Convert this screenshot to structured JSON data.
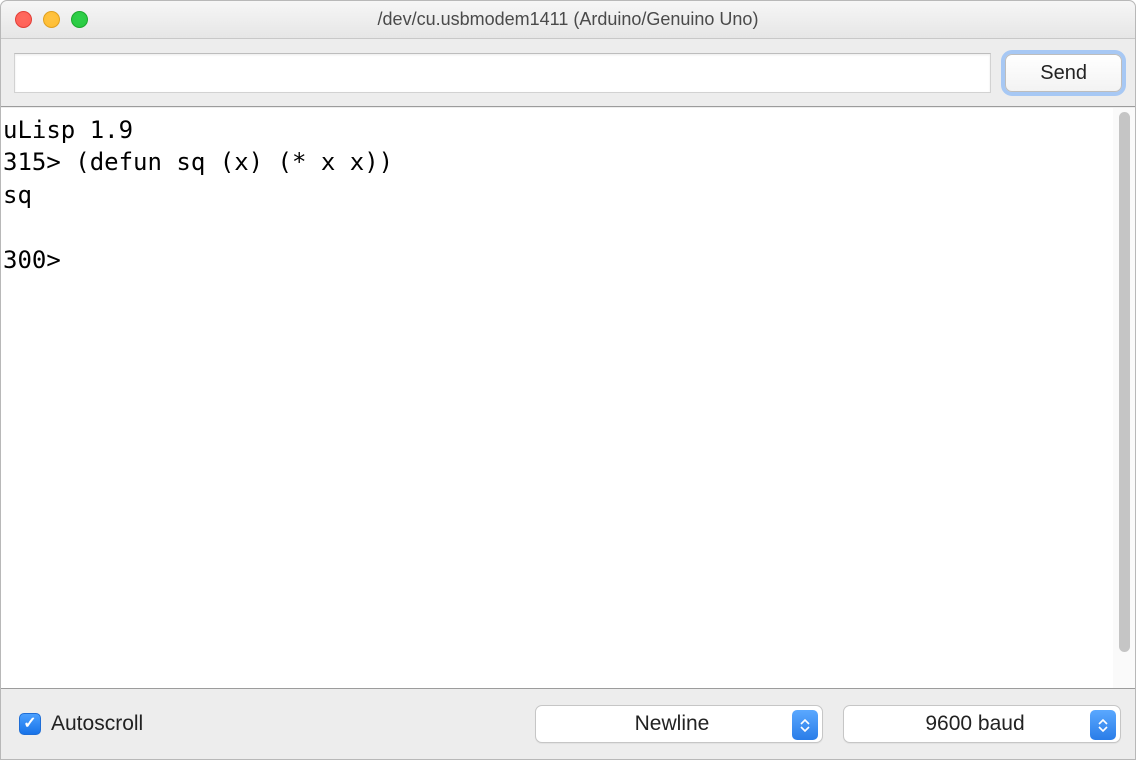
{
  "window": {
    "title": "/dev/cu.usbmodem1411 (Arduino/Genuino Uno)"
  },
  "toolbar": {
    "command_value": "",
    "send_label": "Send"
  },
  "output": {
    "content": "uLisp 1.9\n315> (defun sq (x) (* x x))\nsq\n\n300> "
  },
  "bottombar": {
    "autoscroll_label": "Autoscroll",
    "autoscroll_checked": true,
    "line_ending_select": "Newline",
    "baud_select": "9600 baud"
  }
}
